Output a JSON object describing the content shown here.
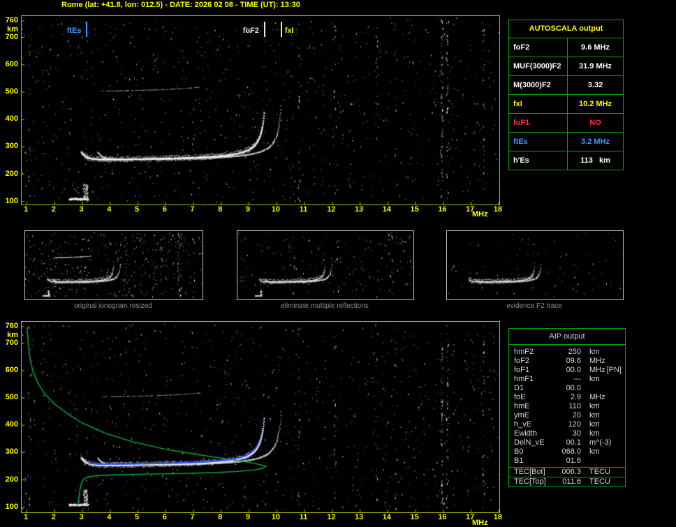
{
  "title": "Rome (lat: +41.8, lon: 012.5) - DATE: 2026 02 08 - TIME (UT): 13:30",
  "axes": {
    "x_unit": "MHz",
    "y_unit": "km",
    "x_ticks": [
      1,
      2,
      3,
      4,
      5,
      6,
      7,
      8,
      9,
      10,
      11,
      12,
      13,
      14,
      15,
      16,
      17,
      18
    ],
    "y_ticks": [
      760,
      700,
      600,
      500,
      400,
      300,
      200,
      100
    ]
  },
  "autoscala_table": {
    "title": "AUTOSCALA output",
    "rows": [
      {
        "label": "foF2",
        "value": "9.6 MHz",
        "color": "#ffffff"
      },
      {
        "label": "MUF(3000)F2",
        "value": "31.9 MHz",
        "color": "#ffffff"
      },
      {
        "label": "M(3000)F2",
        "value": "3.32",
        "color": "#ffffff"
      },
      {
        "label": "fxI",
        "value": "10.2 MHz",
        "color": "#ffff00"
      },
      {
        "label": "foF1",
        "value": "NO",
        "color": "#ff3232"
      },
      {
        "label": "ftEs",
        "value": "3.2 MHz",
        "color": "#3b9bff"
      },
      {
        "label": "h'Es",
        "value": "113   km",
        "color": "#ffffff"
      }
    ]
  },
  "aip_table": {
    "title": "AIP output",
    "rows": [
      {
        "label": "hmF2",
        "value": "250",
        "unit": "km",
        "extra": ""
      },
      {
        "label": "foF2",
        "value": "09.6",
        "unit": "MHz",
        "extra": ""
      },
      {
        "label": "foF1",
        "value": "00.0",
        "unit": "MHz",
        "extra": "[PN]"
      },
      {
        "label": "hmF1",
        "value": "---",
        "unit": "km",
        "extra": ""
      },
      {
        "label": "D1",
        "value": "00.0",
        "unit": "",
        "extra": ""
      },
      {
        "label": "foE",
        "value": "2.9",
        "unit": "MHz",
        "extra": ""
      },
      {
        "label": "hmE",
        "value": "110",
        "unit": "km",
        "extra": ""
      },
      {
        "label": "ymE",
        "value": "20",
        "unit": "km",
        "extra": ""
      },
      {
        "label": "h_vE",
        "value": "120",
        "unit": "km",
        "extra": ""
      },
      {
        "label": "Ewidth",
        "value": "30",
        "unit": "km",
        "extra": ""
      },
      {
        "label": "DelN_vE",
        "value": "00.1",
        "unit": "m^(-3)",
        "extra": ""
      },
      {
        "label": "B0",
        "value": "068.0",
        "unit": "km",
        "extra": ""
      },
      {
        "label": "B1",
        "value": "01.6",
        "unit": "",
        "extra": ""
      }
    ],
    "tec_rows": [
      {
        "label": "TEC[Bot]",
        "value": "006.3",
        "unit": "TECU"
      },
      {
        "label": "TEC[Top]",
        "value": "011.6",
        "unit": "TECU"
      }
    ]
  },
  "thumbnails": {
    "captions": [
      "original ionogram resized",
      "eliminate multiple reflections",
      "evidence F2 trace"
    ]
  },
  "chart_data": [
    {
      "id": "main_ionogram",
      "type": "scatter",
      "title": "ionogram with autoscaled characteristic frequencies",
      "xlabel": "MHz",
      "ylabel": "km",
      "xlim": [
        1,
        18
      ],
      "ylim": [
        100,
        760
      ],
      "markers": [
        {
          "label": "ftEs",
          "freq_mhz": 3.2,
          "color": "#3b9bff",
          "label_side": "left"
        },
        {
          "label": "foF2",
          "freq_mhz": 9.6,
          "color": "#e9e9e9",
          "label_side": "left"
        },
        {
          "label": "fxI",
          "freq_mhz": 10.2,
          "color": "#ffff00",
          "label_side": "right"
        }
      ],
      "traces": {
        "es_layer": {
          "virtual_height_km": 113,
          "top_freq_mhz": 3.2
        },
        "f_region_o_trace": {
          "min_virtual_height_km": 250,
          "critical_freq_mhz": 9.6,
          "max_virtual_height_km": 430
        },
        "f_region_x_trace": {
          "critical_freq_mhz": 10.2
        },
        "second_order_reflection": {
          "virtual_height_km": 500,
          "freq_range_mhz": [
            3.7,
            7.2
          ]
        }
      },
      "noise_columns": [
        [
          1.1,
          12
        ],
        [
          10.8,
          20
        ],
        [
          12.1,
          12
        ],
        [
          13.6,
          12
        ],
        [
          14.3,
          10
        ],
        [
          15.95,
          70
        ],
        [
          16.15,
          45
        ],
        [
          17.45,
          28
        ]
      ]
    },
    {
      "id": "thumb_original",
      "type": "scatter",
      "caption": "original ionogram resized"
    },
    {
      "id": "thumb_no_multiples",
      "type": "scatter",
      "caption": "eliminate multiple reflections"
    },
    {
      "id": "thumb_f2_evidence",
      "type": "scatter",
      "caption": "evidence F2 trace"
    },
    {
      "id": "profile_ionogram",
      "type": "scatter",
      "xlabel": "MHz",
      "ylabel": "km",
      "xlim": [
        1,
        18
      ],
      "ylim": [
        100,
        760
      ],
      "overlays": {
        "electron_density_profile": {
          "color": "#00b63c",
          "points_f_km": [
            [
              1.02,
              758
            ],
            [
              1.06,
              700
            ],
            [
              1.12,
              648
            ],
            [
              1.22,
              600
            ],
            [
              1.4,
              555
            ],
            [
              1.65,
              515
            ],
            [
              2.0,
              478
            ],
            [
              2.5,
              440
            ],
            [
              3.0,
              408
            ],
            [
              3.8,
              372
            ],
            [
              4.8,
              340
            ],
            [
              6.0,
              312
            ],
            [
              7.2,
              292
            ],
            [
              8.2,
              277
            ],
            [
              8.9,
              266
            ],
            [
              9.35,
              257
            ],
            [
              9.55,
              252
            ],
            [
              9.62,
              250
            ],
            [
              9.5,
              242
            ],
            [
              9.2,
              236
            ],
            [
              8.6,
              231
            ],
            [
              7.8,
              227
            ],
            [
              6.8,
              224
            ],
            [
              5.8,
              222
            ],
            [
              4.8,
              220
            ],
            [
              4.0,
              218
            ],
            [
              3.5,
              215
            ],
            [
              3.2,
              211
            ],
            [
              3.05,
              202
            ],
            [
              2.97,
              186
            ],
            [
              2.92,
              162
            ],
            [
              2.89,
              138
            ],
            [
              2.86,
              116
            ],
            [
              2.84,
              104
            ]
          ]
        },
        "fitted_trace": {
          "color": "#2e54ff",
          "hmF2_km": 250,
          "foF2_mhz": 9.6
        }
      }
    }
  ]
}
